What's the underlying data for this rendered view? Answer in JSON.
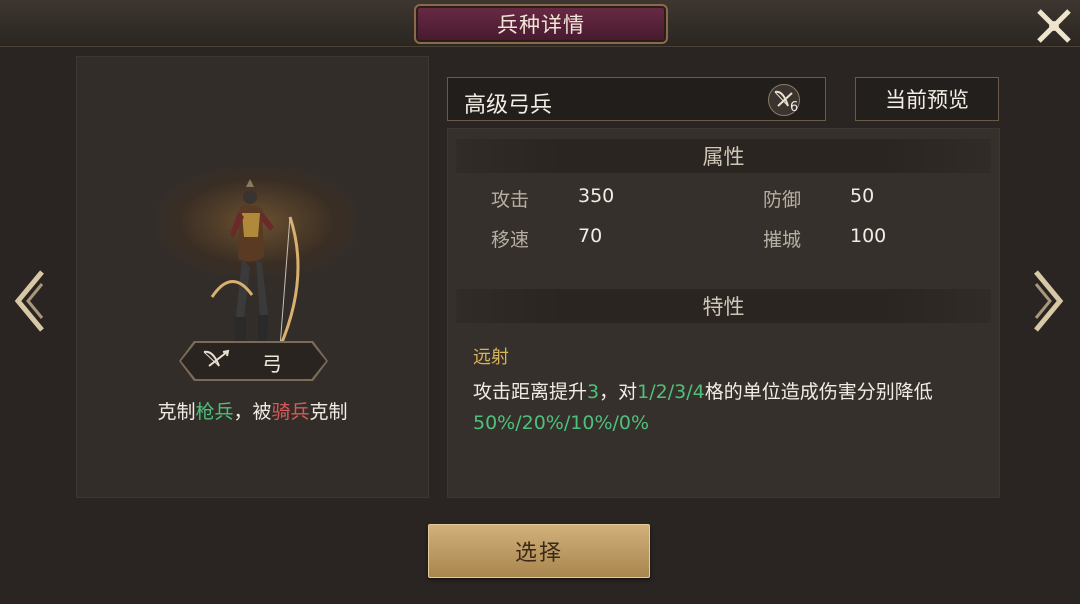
{
  "header": {
    "title": "兵种详情",
    "close_icon": "close-x-icon"
  },
  "unit": {
    "name": "高级弓兵",
    "type_icon": "bow-icon",
    "level": "6",
    "type_label": "弓",
    "counter": {
      "prefix": "克制",
      "strong_against": "枪兵",
      "middle": "，被",
      "weak_against": "骑兵",
      "suffix": "克制"
    }
  },
  "preview_button": "当前预览",
  "attributes": {
    "heading": "属性",
    "attack_label": "攻击",
    "attack_value": "350",
    "defense_label": "防御",
    "defense_value": "50",
    "speed_label": "移速",
    "speed_value": "70",
    "siege_label": "摧城",
    "siege_value": "100"
  },
  "traits": {
    "heading": "特性",
    "name": "远射",
    "desc_1": "攻击距离提升",
    "desc_2": "3",
    "desc_3": "，对",
    "desc_4": "1/2/3/4",
    "desc_5": "格的单位造成伤害分别降低",
    "desc_6": "50%/20%/10%/0%"
  },
  "select_button": "选择",
  "colors": {
    "highlight_green": "#4ec07c",
    "highlight_red": "#d85a5a",
    "trait_gold": "#d9b25a",
    "title_plate": "#5a2238"
  }
}
